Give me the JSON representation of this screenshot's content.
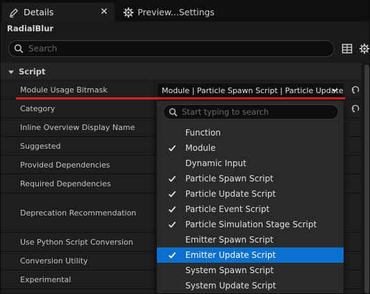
{
  "tabs": [
    {
      "label": "Details",
      "icon": "pencil-icon",
      "active": true
    },
    {
      "label": "Preview...Settings",
      "icon": "gear-icon",
      "active": false
    }
  ],
  "object_name": "RadialBlur",
  "search": {
    "placeholder": "Search",
    "value": ""
  },
  "category": {
    "label": "Script",
    "expanded": true
  },
  "properties": [
    {
      "name": "Module Usage Bitmask",
      "value": "Module | Particle Spawn Script | Particle Update Script"
    },
    {
      "name": "Category"
    },
    {
      "name": "Inline Overview Display Name"
    },
    {
      "name": "Suggested"
    },
    {
      "name": "Provided Dependencies"
    },
    {
      "name": "Required Dependencies"
    },
    {
      "name": "Deprecation Recommendation"
    },
    {
      "name": "Use Python Script Conversion"
    },
    {
      "name": "Conversion Utility"
    },
    {
      "name": "Experimental"
    }
  ],
  "dropdown": {
    "search_placeholder": "Start typing to search",
    "items": [
      {
        "label": "Function",
        "checked": false,
        "highlighted": false
      },
      {
        "label": "Module",
        "checked": true,
        "highlighted": false
      },
      {
        "label": "Dynamic Input",
        "checked": false,
        "highlighted": false
      },
      {
        "label": "Particle Spawn Script",
        "checked": true,
        "highlighted": false
      },
      {
        "label": "Particle Update Script",
        "checked": true,
        "highlighted": false
      },
      {
        "label": "Particle Event Script",
        "checked": true,
        "highlighted": false
      },
      {
        "label": "Particle Simulation Stage Script",
        "checked": true,
        "highlighted": false
      },
      {
        "label": "Emitter Spawn Script",
        "checked": false,
        "highlighted": false
      },
      {
        "label": "Emitter Update Script",
        "checked": true,
        "highlighted": true
      },
      {
        "label": "System Spawn Script",
        "checked": false,
        "highlighted": false
      },
      {
        "label": "System Update Script",
        "checked": false,
        "highlighted": false
      }
    ]
  },
  "colors": {
    "highlight": "#0b6fd0",
    "annotation_underline": "#e0201d"
  }
}
